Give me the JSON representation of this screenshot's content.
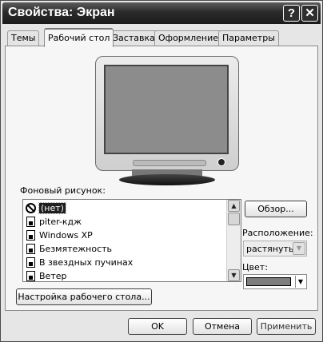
{
  "window": {
    "title": "Свойства: Экран",
    "help_label": "?",
    "close_label": "✕"
  },
  "tabs": [
    {
      "label": "Темы",
      "active": false
    },
    {
      "label": "Рабочий стол",
      "active": true
    },
    {
      "label": "Заставка",
      "active": false
    },
    {
      "label": "Оформление",
      "active": false
    },
    {
      "label": "Параметры",
      "active": false
    }
  ],
  "desktop": {
    "background_label": "Фоновый рисунок:",
    "backgrounds": [
      {
        "label": "(нет)",
        "icon": "none-icon",
        "selected": true
      },
      {
        "label": "piter-кдж",
        "icon": "image-file-icon",
        "selected": false
      },
      {
        "label": "Windows XP",
        "icon": "image-file-icon",
        "selected": false
      },
      {
        "label": "Безмятежность",
        "icon": "image-file-icon",
        "selected": false
      },
      {
        "label": "В звездных пучинах",
        "icon": "image-file-icon",
        "selected": false
      },
      {
        "label": "Ветер",
        "icon": "image-file-icon",
        "selected": false
      }
    ],
    "browse_label": "Обзор...",
    "position_label": "Расположение:",
    "position_value": "растянуть",
    "color_label": "Цвет:",
    "color_value": "#7d7d7d",
    "customize_label": "Настройка рабочего стола..."
  },
  "footer": {
    "ok_label": "OK",
    "cancel_label": "Отмена",
    "apply_label": "Применить"
  }
}
